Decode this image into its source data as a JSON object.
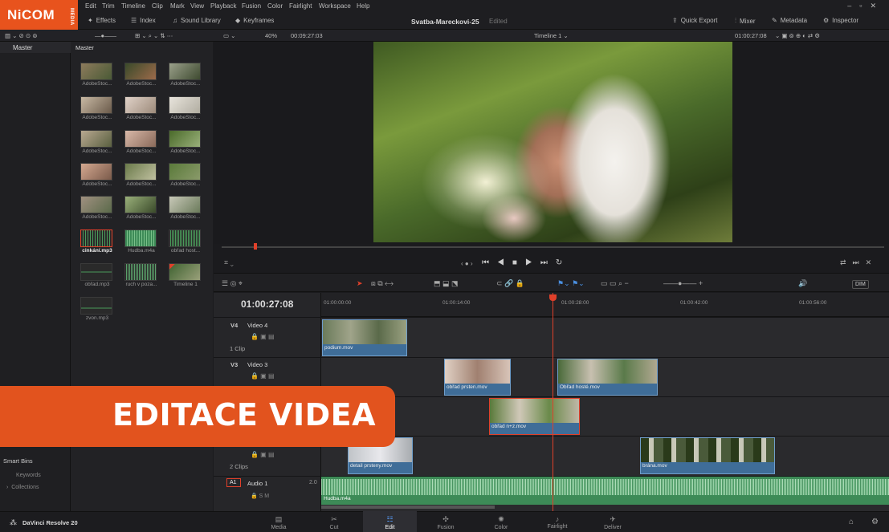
{
  "brand": {
    "logo": "NiCOM",
    "logo_sub": "MEDIA",
    "accent": "#e8531d"
  },
  "menu": [
    "Edit",
    "Trim",
    "Timeline",
    "Clip",
    "Mark",
    "View",
    "Playback",
    "Fusion",
    "Color",
    "Fairlight",
    "Workspace",
    "Help"
  ],
  "toolbar": {
    "effects": "Effects",
    "index": "Index",
    "sound_library": "Sound Library",
    "keyframes": "Keyframes",
    "project_title": "Svatba-Mareckovi-25",
    "project_state": "Edited",
    "quick_export": "Quick Export",
    "mixer": "Mixer",
    "metadata": "Metadata",
    "inspector": "Inspector"
  },
  "viewer_bar": {
    "zoom": "40%",
    "duration": "00:09:27:03",
    "timeline_name": "Timeline 1",
    "timecode": "01:00:27:08"
  },
  "bins": {
    "header": "Master",
    "pool_header": "Master",
    "smart_bins": "Smart Bins",
    "keywords": "Keywords",
    "collections": "Collections"
  },
  "clips": [
    {
      "label": "AdobeStoc..."
    },
    {
      "label": "AdobeStoc..."
    },
    {
      "label": "AdobeStoc..."
    },
    {
      "label": "AdobeStoc..."
    },
    {
      "label": "AdobeStoc..."
    },
    {
      "label": "AdobeStoc..."
    },
    {
      "label": "AdobeStoc..."
    },
    {
      "label": "AdobeStoc..."
    },
    {
      "label": "AdobeStoc..."
    },
    {
      "label": "AdobeStoc..."
    },
    {
      "label": "AdobeStoc..."
    },
    {
      "label": "AdobeStoc..."
    },
    {
      "label": "AdobeStoc..."
    },
    {
      "label": "AdobeStoc..."
    },
    {
      "label": "AdobeStoc..."
    },
    {
      "label": "cinkání.mp3"
    },
    {
      "label": "Hudba.m4a"
    },
    {
      "label": "obřad host..."
    },
    {
      "label": "obřad.mp3"
    },
    {
      "label": "ruch v poza..."
    },
    {
      "label": "Timeline 1"
    },
    {
      "label": "zvon.mp3"
    }
  ],
  "timeline": {
    "timecode": "01:00:27:08",
    "ticks": [
      "01:00:00:00",
      "01:00:14:00",
      "01:00:28:00",
      "01:00:42:00",
      "01:00:56:00"
    ],
    "tracks": {
      "v4": {
        "id": "V4",
        "name": "Video 4",
        "count": "1 Clip"
      },
      "v3": {
        "id": "V3",
        "name": "Video 3"
      },
      "v1": {
        "count": "2 Clips"
      },
      "a1": {
        "id": "A1",
        "name": "Audio 1",
        "level": "2.0"
      }
    },
    "clips": {
      "podium": "podium.mov",
      "prsten": "obřad prsten.mov",
      "hoste": "Obřad hosté.mov",
      "nz": "obřad n+z.mov",
      "detail": "detail prsteny.mov",
      "brana": "brána.mov",
      "hudba": "Hudba.m4a"
    },
    "dim": "DIM"
  },
  "pages": [
    "Media",
    "Cut",
    "Edit",
    "Fusion",
    "Color",
    "Fairlight",
    "Deliver"
  ],
  "active_page": "Edit",
  "app_name": "DaVinci Resolve 20",
  "banner": "EDITACE VIDEA"
}
